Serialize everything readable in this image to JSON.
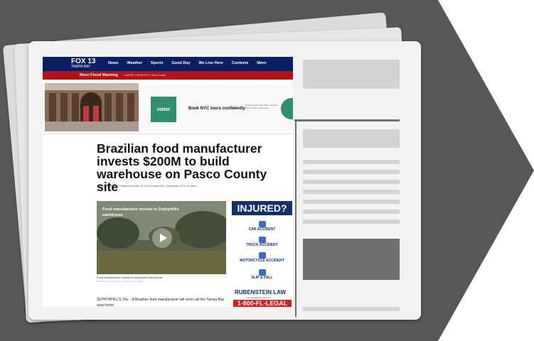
{
  "colors": {
    "background": "#555555",
    "nav": "#0a1e64",
    "alert": "#b01414",
    "accent": "#2f8f6e"
  },
  "site": {
    "logo": "FOX 13",
    "logo_sub": "TAMPA BAY",
    "nav": [
      "News",
      "Weather",
      "Sports",
      "Good Day",
      "We Live Here",
      "Contests",
      "More"
    ],
    "alert_title": "River Flood Warning",
    "alert_detail": "until FRI 7:00 PM EDT, Citrus County"
  },
  "ad": {
    "brand": "viator",
    "tagline": "Book NYC tours confidently",
    "small_print": "Read reviews from 10M+ travelers across 300K experiences"
  },
  "article": {
    "headline": "Brazilian food manufacturer invests $200M to build warehouse on Pasco County site",
    "byline": "By Jennifer Kragie  |  Published  October 16, 2023 6:18pm EDT  |  Zephyrhills  |  FOX 13 News",
    "video_title": "Food manufacturer invests in Zephyrhills warehouse",
    "caption": "Food manufacturer invests in Zephyrhills warehouse",
    "caption_small": "Brazilian food manufacturer invests in Zephyrhills",
    "lead": "ZEPHYRHILLS, Fla. - A Brazilian food manufacturer will soon call the Tampa Bay area home."
  },
  "side_ad": {
    "title": "INJURED?",
    "items": [
      "CAR ACCIDENT",
      "TRUCK ACCIDENT",
      "MOTORCYCLE ACCIDENT",
      "SLIP & FALL"
    ],
    "firm": "RUBENSTEIN LAW",
    "firm_sub": "Your Hometown Law Firm",
    "phone": "1-800-FL-LEGAL"
  }
}
